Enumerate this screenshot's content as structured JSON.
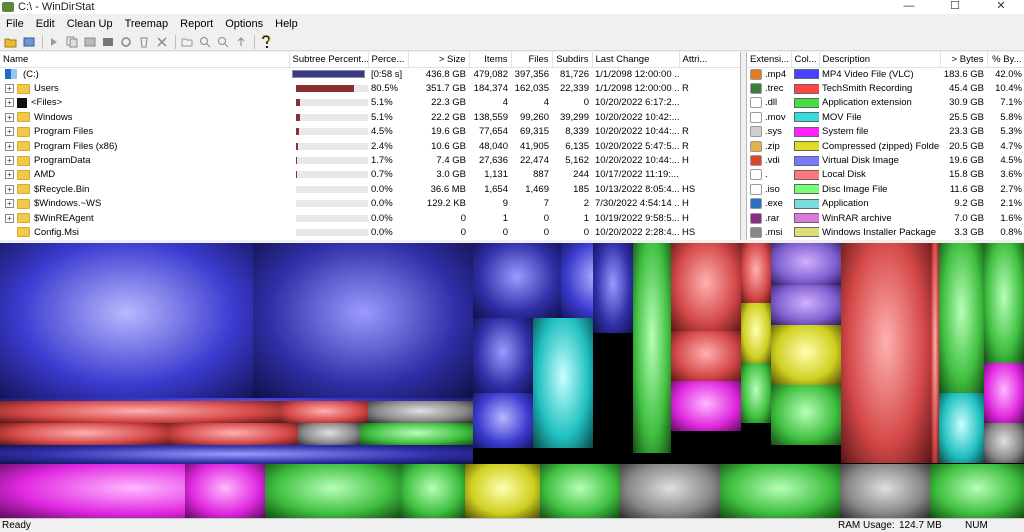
{
  "window": {
    "title": "C:\\ - WinDirStat",
    "minimize": "—",
    "maximize": "☐",
    "close": "✕"
  },
  "menu": [
    "File",
    "Edit",
    "Clean Up",
    "Treemap",
    "Report",
    "Options",
    "Help"
  ],
  "tree": {
    "headers": {
      "name": "Name",
      "subtree": "Subtree Percent...",
      "perc": "Perce...",
      "size": "> Size",
      "items": "Items",
      "files": "Files",
      "subdirs": "Subdirs",
      "lastchange": "Last Change",
      "attr": "Attri..."
    },
    "rows": [
      {
        "name": "(C:)",
        "kind": "drive",
        "subtree_pct": 1.0,
        "perc": "[0:58 s]",
        "size": "436.8 GB",
        "items": "479,082",
        "files": "397,356",
        "subdirs": "81,726",
        "lastchange": "1/1/2098 12:00:00 ...",
        "attr": ""
      },
      {
        "name": "Users",
        "kind": "folder",
        "subtree_pct": 0.805,
        "perc": "80.5%",
        "size": "351.7 GB",
        "items": "184,374",
        "files": "162,035",
        "subdirs": "22,339",
        "lastchange": "1/1/2098 12:00:00 ...",
        "attr": "R"
      },
      {
        "name": "<Files>",
        "kind": "files",
        "subtree_pct": 0.051,
        "perc": "5.1%",
        "size": "22.3 GB",
        "items": "4",
        "files": "4",
        "subdirs": "0",
        "lastchange": "10/20/2022 6:17:2...",
        "attr": ""
      },
      {
        "name": "Windows",
        "kind": "folder",
        "subtree_pct": 0.051,
        "perc": "5.1%",
        "size": "22.2 GB",
        "items": "138,559",
        "files": "99,260",
        "subdirs": "39,299",
        "lastchange": "10/20/2022 10:42:...",
        "attr": ""
      },
      {
        "name": "Program Files",
        "kind": "folder",
        "subtree_pct": 0.045,
        "perc": "4.5%",
        "size": "19.6 GB",
        "items": "77,654",
        "files": "69,315",
        "subdirs": "8,339",
        "lastchange": "10/20/2022 10:44:...",
        "attr": "R"
      },
      {
        "name": "Program Files (x86)",
        "kind": "folder",
        "subtree_pct": 0.024,
        "perc": "2.4%",
        "size": "10.6 GB",
        "items": "48,040",
        "files": "41,905",
        "subdirs": "6,135",
        "lastchange": "10/20/2022 5:47:5...",
        "attr": "R"
      },
      {
        "name": "ProgramData",
        "kind": "folder",
        "subtree_pct": 0.017,
        "perc": "1.7%",
        "size": "7.4 GB",
        "items": "27,636",
        "files": "22,474",
        "subdirs": "5,162",
        "lastchange": "10/20/2022 10:44:...",
        "attr": "H"
      },
      {
        "name": "AMD",
        "kind": "folder",
        "subtree_pct": 0.007,
        "perc": "0.7%",
        "size": "3.0 GB",
        "items": "1,131",
        "files": "887",
        "subdirs": "244",
        "lastchange": "10/17/2022 11:19:...",
        "attr": ""
      },
      {
        "name": "$Recycle.Bin",
        "kind": "folder",
        "subtree_pct": 0.0,
        "perc": "0.0%",
        "size": "36.6 MB",
        "items": "1,654",
        "files": "1,469",
        "subdirs": "185",
        "lastchange": "10/13/2022 8:05:4...",
        "attr": "HS"
      },
      {
        "name": "$Windows.~WS",
        "kind": "folder",
        "subtree_pct": 0.0,
        "perc": "0.0%",
        "size": "129.2 KB",
        "items": "9",
        "files": "7",
        "subdirs": "2",
        "lastchange": "7/30/2022 4:54:14 ...",
        "attr": "H"
      },
      {
        "name": "$WinREAgent",
        "kind": "folder",
        "subtree_pct": 0.0,
        "perc": "0.0%",
        "size": "0",
        "items": "1",
        "files": "0",
        "subdirs": "1",
        "lastchange": "10/19/2022 9:58:5...",
        "attr": "H"
      },
      {
        "name": "Config.Msi",
        "kind": "folder",
        "subtree_pct": 0.0,
        "perc": "0.0%",
        "size": "0",
        "items": "0",
        "files": "0",
        "subdirs": "0",
        "lastchange": "10/20/2022 2:28:4...",
        "attr": "HS"
      }
    ]
  },
  "ext": {
    "headers": {
      "ext": "Extensi...",
      "color": "Col...",
      "desc": "Description",
      "bytes": "> Bytes",
      "pct": "% By..."
    },
    "rows": [
      {
        "ext": ".mp4",
        "color": "#4444ff",
        "icon": "#e57b1f",
        "desc": "MP4 Video File (VLC)",
        "bytes": "183.6 GB",
        "pct": "42.0%"
      },
      {
        "ext": ".trec",
        "color": "#ff4444",
        "icon": "#3d7d3d",
        "desc": "TechSmith Recording",
        "bytes": "45.4 GB",
        "pct": "10.4%"
      },
      {
        "ext": ".dll",
        "color": "#44dd44",
        "icon": "#ffffff",
        "desc": "Application extension",
        "bytes": "30.9 GB",
        "pct": "7.1%"
      },
      {
        "ext": ".mov",
        "color": "#33dddd",
        "icon": "#ffffff",
        "desc": "MOV File",
        "bytes": "25.5 GB",
        "pct": "5.8%"
      },
      {
        "ext": ".sys",
        "color": "#ff22ff",
        "icon": "#cfcfcf",
        "desc": "System file",
        "bytes": "23.3 GB",
        "pct": "5.3%"
      },
      {
        "ext": ".zip",
        "color": "#dddd22",
        "icon": "#e0b34a",
        "desc": "Compressed (zipped) Folder",
        "bytes": "20.5 GB",
        "pct": "4.7%"
      },
      {
        "ext": ".vdi",
        "color": "#7777ff",
        "icon": "#d9482a",
        "desc": "Virtual Disk Image",
        "bytes": "19.6 GB",
        "pct": "4.5%"
      },
      {
        "ext": ".",
        "color": "#ff7777",
        "icon": "#ffffff",
        "desc": "Local Disk",
        "bytes": "15.8 GB",
        "pct": "3.6%"
      },
      {
        "ext": ".iso",
        "color": "#77ff77",
        "icon": "#ffffff",
        "desc": "Disc Image File",
        "bytes": "11.6 GB",
        "pct": "2.7%"
      },
      {
        "ext": ".exe",
        "color": "#77dddd",
        "icon": "#2a6fc2",
        "desc": "Application",
        "bytes": "9.2 GB",
        "pct": "2.1%"
      },
      {
        "ext": ".rar",
        "color": "#dd77dd",
        "icon": "#8a2d8a",
        "desc": "WinRAR archive",
        "bytes": "7.0 GB",
        "pct": "1.6%"
      },
      {
        "ext": ".msi",
        "color": "#dddd77",
        "icon": "#888888",
        "desc": "Windows Installer Package",
        "bytes": "3.3 GB",
        "pct": "0.8%"
      }
    ]
  },
  "status": {
    "left": "Ready",
    "ram_label": "RAM Usage:",
    "ram_value": "124.7 MB",
    "num": "NUM"
  },
  "colors": {
    "bar_root": "#393b84",
    "bar_fill": "#8b3030"
  }
}
